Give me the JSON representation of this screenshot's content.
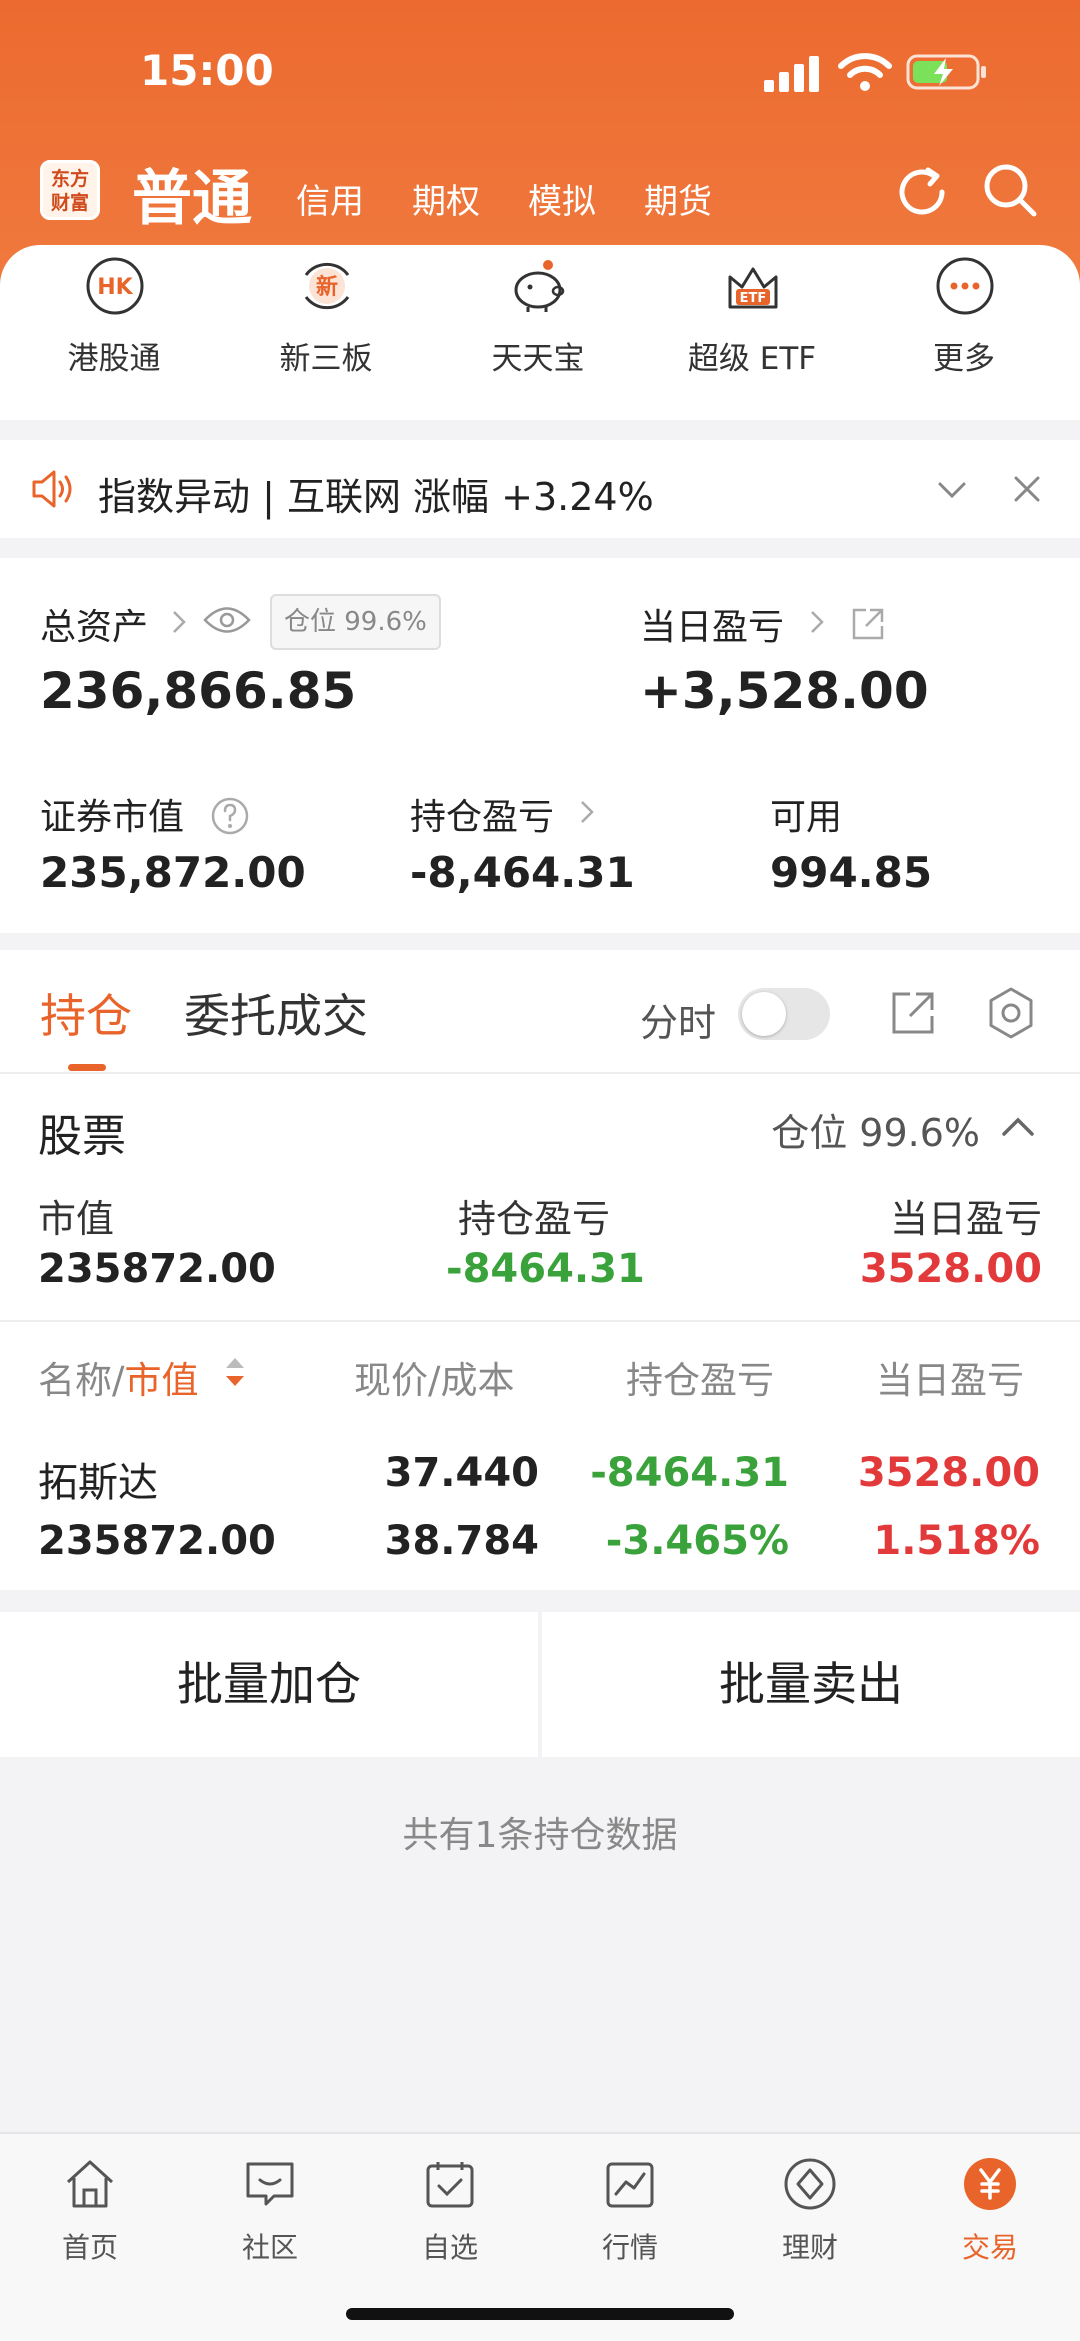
{
  "status": {
    "time": "15:00"
  },
  "header": {
    "logo_line1": "东方",
    "logo_line2": "财富",
    "tab_active": "普通",
    "tabs": [
      "信用",
      "期权",
      "模拟",
      "期货"
    ]
  },
  "quick_menu": [
    {
      "label": "港股通",
      "icon": "hk-icon",
      "glyph": "HK"
    },
    {
      "label": "新三板",
      "icon": "new-board-icon",
      "glyph": "新"
    },
    {
      "label": "天天宝",
      "icon": "piggy-bank-icon"
    },
    {
      "label": "超级 ETF",
      "icon": "etf-crown-icon",
      "glyph": "ETF"
    },
    {
      "label": "更多",
      "icon": "more-icon"
    }
  ],
  "notice": {
    "text": "指数异动 | 互联网 涨幅 +3.24%"
  },
  "assets": {
    "total_label": "总资产",
    "total_value": "236,866.85",
    "position_badge": "仓位 99.6%",
    "daily_pl_label": "当日盈亏",
    "daily_pl_value": "+3,528.00",
    "market_value_label": "证券市值",
    "market_value": "235,872.00",
    "holding_pl_label": "持仓盈亏",
    "holding_pl_value": "-8,464.31",
    "available_label": "可用",
    "available_value": "994.85"
  },
  "holdings": {
    "tab_active": "持仓",
    "tab_other": "委托成交",
    "fenshi_label": "分时",
    "section_title": "股票",
    "section_position": "仓位 99.6%",
    "summary": {
      "market_value_label": "市值",
      "market_value": "235872.00",
      "holding_pl_label": "持仓盈亏",
      "holding_pl": "-8464.31",
      "daily_pl_label": "当日盈亏",
      "daily_pl": "3528.00"
    },
    "columns": {
      "name": "名称",
      "separator": "/",
      "sort_key": "市值",
      "price_cost": "现价/成本",
      "holding_pl": "持仓盈亏",
      "daily_pl": "当日盈亏"
    },
    "rows": [
      {
        "name": "拓斯达",
        "market_value": "235872.00",
        "price": "37.440",
        "cost": "38.784",
        "holding_pl": "-8464.31",
        "holding_pl_pct": "-3.465%",
        "daily_pl": "3528.00",
        "daily_pl_pct": "1.518%"
      }
    ]
  },
  "actions": {
    "batch_add": "批量加仓",
    "batch_sell": "批量卖出"
  },
  "footnote": "共有1条持仓数据",
  "bottom_nav": [
    {
      "label": "首页",
      "icon": "home-icon"
    },
    {
      "label": "社区",
      "icon": "community-icon"
    },
    {
      "label": "自选",
      "icon": "watchlist-icon"
    },
    {
      "label": "行情",
      "icon": "market-chart-icon"
    },
    {
      "label": "理财",
      "icon": "wealth-diamond-icon"
    },
    {
      "label": "交易",
      "icon": "trade-yen-icon",
      "active": true
    }
  ],
  "colors": {
    "brand": "#e8642a",
    "up": "#e23a3a",
    "down": "#3aa23a"
  }
}
